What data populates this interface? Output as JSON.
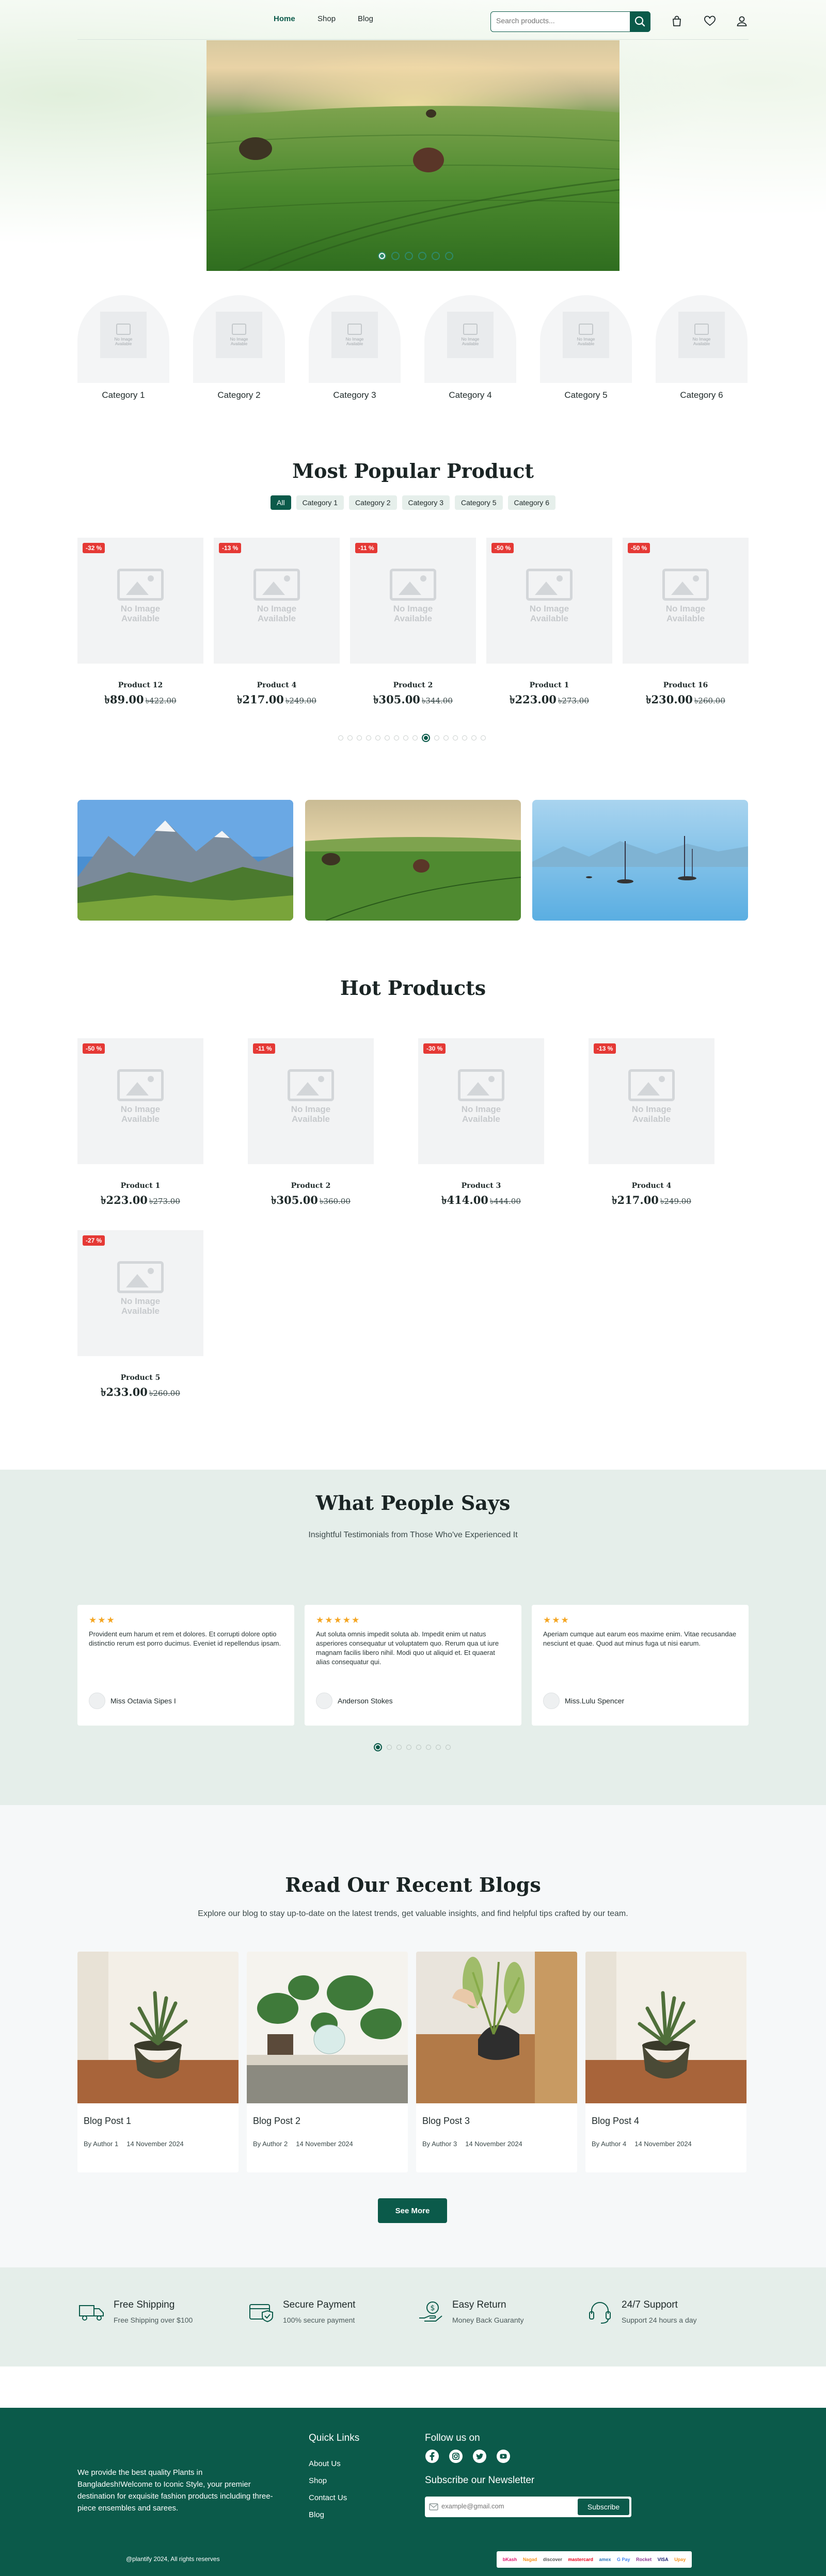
{
  "nav": {
    "links": [
      "Home",
      "Shop",
      "Blog"
    ],
    "search_placeholder": "Search products..."
  },
  "hero": {
    "slides": 6,
    "active_slide": 1
  },
  "categories": [
    "Category 1",
    "Category 2",
    "Category 3",
    "Category 4",
    "Category 5",
    "Category 6"
  ],
  "category_placeholder": [
    "No Image",
    "Available"
  ],
  "popular": {
    "title": "Most Popular Product",
    "filters": [
      "All",
      "Category 1",
      "Category 2",
      "Category 3",
      "Category 5",
      "Category 6"
    ],
    "products": [
      {
        "badge": "-32 %",
        "name": "Product 12",
        "price": "৳89.00",
        "old": "৳422.00"
      },
      {
        "badge": "-13 %",
        "name": "Product 4",
        "price": "৳217.00",
        "old": "৳249.00"
      },
      {
        "badge": "-11 %",
        "name": "Product 2",
        "price": "৳305.00",
        "old": "৳344.00"
      },
      {
        "badge": "-50 %",
        "name": "Product 1",
        "price": "৳223.00",
        "old": "৳273.00"
      },
      {
        "badge": "-50 %",
        "name": "Product 16",
        "price": "৳230.00",
        "old": "৳260.00"
      }
    ],
    "pager_count": 16,
    "pager_active": 9
  },
  "no_image": [
    "No Image",
    "Available"
  ],
  "hot": {
    "title": "Hot Products",
    "products": [
      {
        "badge": "-50 %",
        "name": "Product 1",
        "price": "৳223.00",
        "old": "৳273.00"
      },
      {
        "badge": "-11 %",
        "name": "Product 2",
        "price": "৳305.00",
        "old": "৳360.00"
      },
      {
        "badge": "-30 %",
        "name": "Product 3",
        "price": "৳414.00",
        "old": "৳444.00"
      },
      {
        "badge": "-13 %",
        "name": "Product 4",
        "price": "৳217.00",
        "old": "৳249.00"
      },
      {
        "badge": "-27 %",
        "name": "Product 5",
        "price": "৳233.00",
        "old": "৳260.00"
      }
    ]
  },
  "testimonials": {
    "title": "What People Says",
    "subtitle": "Insightful Testimonials from Those Who've Experienced It",
    "items": [
      {
        "stars": "★★★",
        "text": "Provident eum harum et rem et dolores. Et corrupti dolore optio distinctio rerum est porro ducimus. Eveniet id repellendus ipsam.",
        "author": "Miss Octavia Sipes I"
      },
      {
        "stars": "★★★★★",
        "text": "Aut soluta omnis impedit soluta ab. Impedit enim ut natus asperiores consequatur ut voluptatem quo. Rerum qua ut iure magnam facilis libero nihil. Modi quo ut aliquid et. Et quaerat alias consequatur qui.",
        "author": "Anderson Stokes"
      },
      {
        "stars": "★★★",
        "text": "Aperiam cumque aut earum eos maxime enim. Vitae recusandae nesciunt et quae. Quod aut minus fuga ut nisi earum.",
        "author": "Miss.Lulu Spencer"
      }
    ],
    "pager_count": 8,
    "pager_active": 0
  },
  "blogs": {
    "title": "Read Our Recent Blogs",
    "subtitle": "Explore our blog to stay up-to-date on the latest trends, get valuable insights, and find helpful tips crafted by our team.",
    "posts": [
      {
        "title": "Blog Post 1",
        "author": "By Author 1",
        "date": "14 November 2024"
      },
      {
        "title": "Blog Post 2",
        "author": "By Author 2",
        "date": "14 November 2024"
      },
      {
        "title": "Blog Post 3",
        "author": "By Author 3",
        "date": "14 November 2024"
      },
      {
        "title": "Blog Post 4",
        "author": "By Author 4",
        "date": "14 November 2024"
      }
    ],
    "see_more": "See More"
  },
  "features": [
    {
      "icon": "truck-icon",
      "title": "Free Shipping",
      "sub": "Free Shipping over $100"
    },
    {
      "icon": "secure-payment-icon",
      "title": "Secure Payment",
      "sub": "100% secure payment"
    },
    {
      "icon": "easy-return-icon",
      "title": "Easy Return",
      "sub": "Money Back Guaranty"
    },
    {
      "icon": "headset-icon",
      "title": "24/7 Support",
      "sub": "Support 24 hours a day"
    }
  ],
  "footer": {
    "about": "We provide the best quality Plants in Bangladesh!Welcome to Iconic Style, your premier destination for exquisite fashion products including three-piece ensembles and sarees.",
    "quick_links_title": "Quick Links",
    "quick_links": [
      "About Us",
      "Shop",
      "Contact Us",
      "Blog"
    ],
    "follow_title": "Follow us on",
    "socials": [
      "facebook-icon",
      "instagram-icon",
      "twitter-icon",
      "youtube-icon"
    ],
    "newsletter_title": "Subscribe our Newsletter",
    "newsletter_placeholder": "example@gmail.com",
    "subscribe": "Subscribe",
    "copyright": "@plantify 2024, All rights reserves",
    "payments": [
      "bKash",
      "Nagad",
      "discover",
      "mastercard",
      "amex",
      "G Pay",
      "Rocket",
      "VISA",
      "Upay"
    ]
  },
  "colors": {
    "brand": "#0b5a4a",
    "badge": "#e53935",
    "star": "#f5a623"
  }
}
